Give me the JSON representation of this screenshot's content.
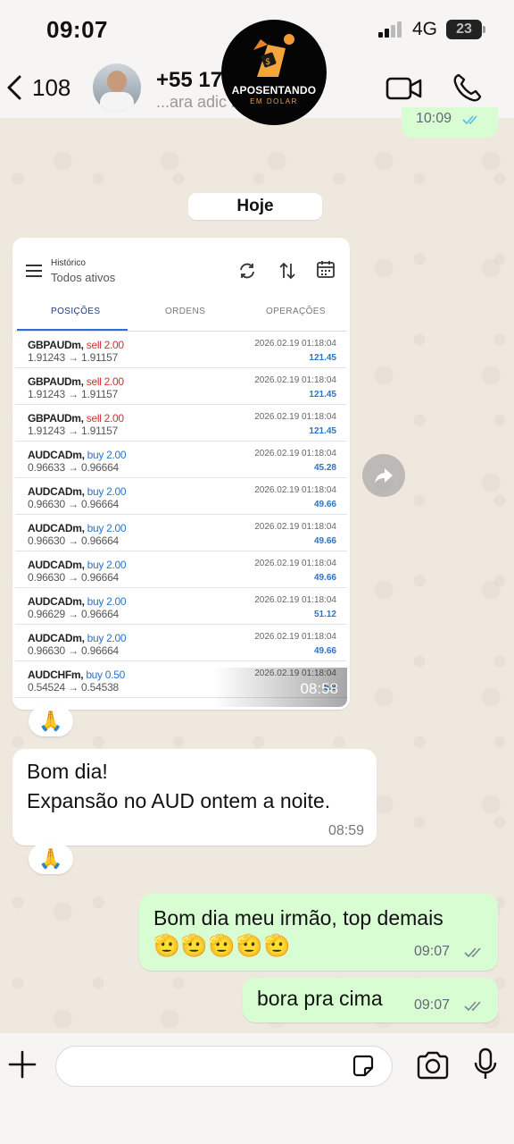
{
  "status_bar": {
    "time": "09:07",
    "network": "4G",
    "battery": "23"
  },
  "header": {
    "back_count": "108",
    "contact_number": "+55 17          517",
    "contact_sub": "...ara adic             ntatos"
  },
  "logo": {
    "title": "APOSENTANDO",
    "subtitle": "EM DOLAR"
  },
  "previous_message": {
    "time": "10:09"
  },
  "date_separator": "Hoje",
  "screenshot_message": {
    "history_label": "Histórico",
    "filter_label": "Todos ativos",
    "tabs": [
      "POSIÇÕES",
      "ORDENS",
      "OPERAÇÕES"
    ],
    "trades": [
      {
        "symbol": "GBPAUDm,",
        "side": "sell 2.00",
        "type": "sell",
        "prices": "1.91243 → 1.91157",
        "date": "2026.02.19 01:18:04",
        "profit": "121.45"
      },
      {
        "symbol": "GBPAUDm,",
        "side": "sell 2.00",
        "type": "sell",
        "prices": "1.91243 → 1.91157",
        "date": "2026.02.19 01:18:04",
        "profit": "121.45"
      },
      {
        "symbol": "GBPAUDm,",
        "side": "sell 2.00",
        "type": "sell",
        "prices": "1.91243 → 1.91157",
        "date": "2026.02.19 01:18:04",
        "profit": "121.45"
      },
      {
        "symbol": "AUDCADm,",
        "side": "buy 2.00",
        "type": "buy",
        "prices": "0.96633 → 0.96664",
        "date": "2026.02.19 01:18:04",
        "profit": "45.28"
      },
      {
        "symbol": "AUDCADm,",
        "side": "buy 2.00",
        "type": "buy",
        "prices": "0.96630 → 0.96664",
        "date": "2026.02.19 01:18:04",
        "profit": "49.66"
      },
      {
        "symbol": "AUDCADm,",
        "side": "buy 2.00",
        "type": "buy",
        "prices": "0.96630 → 0.96664",
        "date": "2026.02.19 01:18:04",
        "profit": "49.66"
      },
      {
        "symbol": "AUDCADm,",
        "side": "buy 2.00",
        "type": "buy",
        "prices": "0.96630 → 0.96664",
        "date": "2026.02.19 01:18:04",
        "profit": "49.66"
      },
      {
        "symbol": "AUDCADm,",
        "side": "buy 2.00",
        "type": "buy",
        "prices": "0.96629 → 0.96664",
        "date": "2026.02.19 01:18:04",
        "profit": "51.12"
      },
      {
        "symbol": "AUDCADm,",
        "side": "buy 2.00",
        "type": "buy",
        "prices": "0.96630 → 0.96664",
        "date": "2026.02.19 01:18:04",
        "profit": "49.66"
      },
      {
        "symbol": "AUDCHFm,",
        "side": "buy 0.50",
        "type": "buy",
        "prices": "0.54524 → 0.54538",
        "date": "2026.02.19 01:18:04",
        "profit": "5.9"
      }
    ],
    "time": "08:58"
  },
  "reactions": {
    "first": "🙏",
    "second": "🙏"
  },
  "incoming_message": {
    "line1": "Bom dia!",
    "line2": "Expansão no AUD ontem a noite.",
    "time": "08:59"
  },
  "outgoing_messages": [
    {
      "text": "Bom dia meu irmão, top demais",
      "emojis": "🫡🫡🫡🫡🫡",
      "time": "09:07"
    },
    {
      "text": "bora pra cima",
      "time": "09:07"
    }
  ],
  "colors": {
    "outgoing_bubble": "#d9fdd3",
    "sell": "#d23030",
    "buy": "#2a74c9",
    "accent": "#2a6fd6"
  }
}
